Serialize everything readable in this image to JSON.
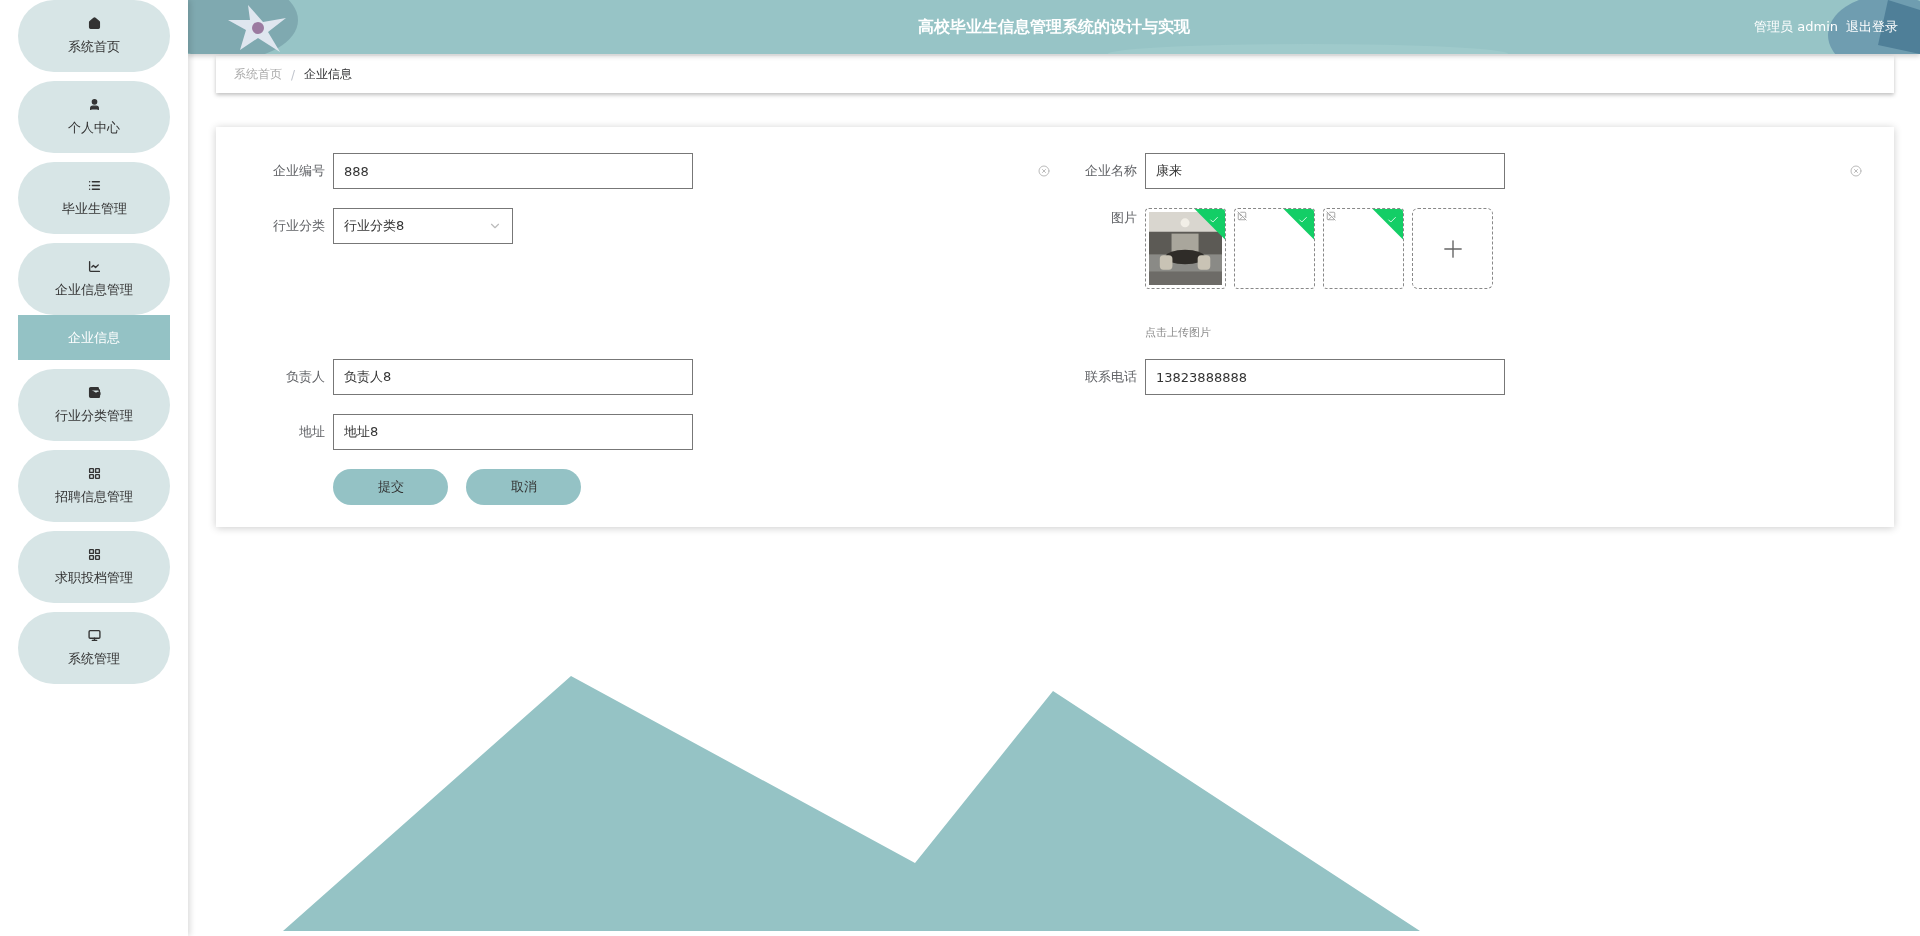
{
  "sidebar": {
    "items": [
      {
        "label": "系统首页"
      },
      {
        "label": "个人中心"
      },
      {
        "label": "毕业生管理"
      },
      {
        "label": "企业信息管理",
        "children": [
          {
            "label": "企业信息",
            "selected": true
          }
        ]
      },
      {
        "label": "行业分类管理"
      },
      {
        "label": "招聘信息管理"
      },
      {
        "label": "求职投档管理"
      },
      {
        "label": "系统管理"
      }
    ]
  },
  "header": {
    "title": "高校毕业生信息管理系统的设计与实现",
    "user": "管理员 admin",
    "logout": "退出登录"
  },
  "breadcrumb": [
    {
      "kind": "link",
      "label": "系统首页",
      "selected": false
    },
    {
      "kind": "separator",
      "label": "/"
    },
    {
      "kind": "link",
      "label": "企业信息",
      "selected": true
    }
  ],
  "form": {
    "code": {
      "label": "企业编号",
      "value": "888"
    },
    "name": {
      "label": "企业名称",
      "value": "康来"
    },
    "category": {
      "label": "行业分类",
      "value": "行业分类8"
    },
    "images": {
      "label": "图片",
      "hint": "点击上传图片",
      "items": [
        {
          "kind": "picture",
          "uploaded": true
        },
        {
          "kind": "broken",
          "uploaded": true
        },
        {
          "kind": "broken",
          "uploaded": true
        }
      ]
    },
    "manager": {
      "label": "负责人",
      "value": "负责人8"
    },
    "phone": {
      "label": "联系电话",
      "value": "13823888888"
    },
    "address": {
      "label": "地址",
      "value": "地址8"
    },
    "buttons": [
      "提交",
      "取消"
    ]
  }
}
